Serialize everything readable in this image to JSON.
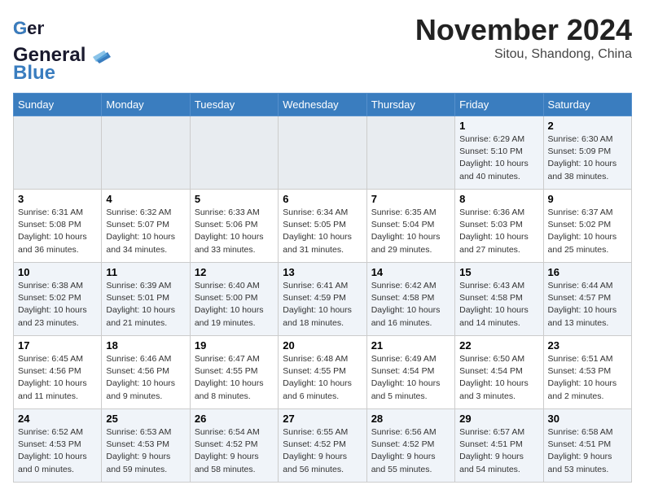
{
  "header": {
    "logo_line1": "General",
    "logo_line2": "Blue",
    "month": "November 2024",
    "location": "Sitou, Shandong, China"
  },
  "weekdays": [
    "Sunday",
    "Monday",
    "Tuesday",
    "Wednesday",
    "Thursday",
    "Friday",
    "Saturday"
  ],
  "weeks": [
    {
      "days": [
        {
          "num": "",
          "detail": "",
          "empty": true
        },
        {
          "num": "",
          "detail": "",
          "empty": true
        },
        {
          "num": "",
          "detail": "",
          "empty": true
        },
        {
          "num": "",
          "detail": "",
          "empty": true
        },
        {
          "num": "",
          "detail": "",
          "empty": true
        },
        {
          "num": "1",
          "detail": "Sunrise: 6:29 AM\nSunset: 5:10 PM\nDaylight: 10 hours\nand 40 minutes.",
          "empty": false
        },
        {
          "num": "2",
          "detail": "Sunrise: 6:30 AM\nSunset: 5:09 PM\nDaylight: 10 hours\nand 38 minutes.",
          "empty": false
        }
      ]
    },
    {
      "days": [
        {
          "num": "3",
          "detail": "Sunrise: 6:31 AM\nSunset: 5:08 PM\nDaylight: 10 hours\nand 36 minutes.",
          "empty": false
        },
        {
          "num": "4",
          "detail": "Sunrise: 6:32 AM\nSunset: 5:07 PM\nDaylight: 10 hours\nand 34 minutes.",
          "empty": false
        },
        {
          "num": "5",
          "detail": "Sunrise: 6:33 AM\nSunset: 5:06 PM\nDaylight: 10 hours\nand 33 minutes.",
          "empty": false
        },
        {
          "num": "6",
          "detail": "Sunrise: 6:34 AM\nSunset: 5:05 PM\nDaylight: 10 hours\nand 31 minutes.",
          "empty": false
        },
        {
          "num": "7",
          "detail": "Sunrise: 6:35 AM\nSunset: 5:04 PM\nDaylight: 10 hours\nand 29 minutes.",
          "empty": false
        },
        {
          "num": "8",
          "detail": "Sunrise: 6:36 AM\nSunset: 5:03 PM\nDaylight: 10 hours\nand 27 minutes.",
          "empty": false
        },
        {
          "num": "9",
          "detail": "Sunrise: 6:37 AM\nSunset: 5:02 PM\nDaylight: 10 hours\nand 25 minutes.",
          "empty": false
        }
      ]
    },
    {
      "days": [
        {
          "num": "10",
          "detail": "Sunrise: 6:38 AM\nSunset: 5:02 PM\nDaylight: 10 hours\nand 23 minutes.",
          "empty": false
        },
        {
          "num": "11",
          "detail": "Sunrise: 6:39 AM\nSunset: 5:01 PM\nDaylight: 10 hours\nand 21 minutes.",
          "empty": false
        },
        {
          "num": "12",
          "detail": "Sunrise: 6:40 AM\nSunset: 5:00 PM\nDaylight: 10 hours\nand 19 minutes.",
          "empty": false
        },
        {
          "num": "13",
          "detail": "Sunrise: 6:41 AM\nSunset: 4:59 PM\nDaylight: 10 hours\nand 18 minutes.",
          "empty": false
        },
        {
          "num": "14",
          "detail": "Sunrise: 6:42 AM\nSunset: 4:58 PM\nDaylight: 10 hours\nand 16 minutes.",
          "empty": false
        },
        {
          "num": "15",
          "detail": "Sunrise: 6:43 AM\nSunset: 4:58 PM\nDaylight: 10 hours\nand 14 minutes.",
          "empty": false
        },
        {
          "num": "16",
          "detail": "Sunrise: 6:44 AM\nSunset: 4:57 PM\nDaylight: 10 hours\nand 13 minutes.",
          "empty": false
        }
      ]
    },
    {
      "days": [
        {
          "num": "17",
          "detail": "Sunrise: 6:45 AM\nSunset: 4:56 PM\nDaylight: 10 hours\nand 11 minutes.",
          "empty": false
        },
        {
          "num": "18",
          "detail": "Sunrise: 6:46 AM\nSunset: 4:56 PM\nDaylight: 10 hours\nand 9 minutes.",
          "empty": false
        },
        {
          "num": "19",
          "detail": "Sunrise: 6:47 AM\nSunset: 4:55 PM\nDaylight: 10 hours\nand 8 minutes.",
          "empty": false
        },
        {
          "num": "20",
          "detail": "Sunrise: 6:48 AM\nSunset: 4:55 PM\nDaylight: 10 hours\nand 6 minutes.",
          "empty": false
        },
        {
          "num": "21",
          "detail": "Sunrise: 6:49 AM\nSunset: 4:54 PM\nDaylight: 10 hours\nand 5 minutes.",
          "empty": false
        },
        {
          "num": "22",
          "detail": "Sunrise: 6:50 AM\nSunset: 4:54 PM\nDaylight: 10 hours\nand 3 minutes.",
          "empty": false
        },
        {
          "num": "23",
          "detail": "Sunrise: 6:51 AM\nSunset: 4:53 PM\nDaylight: 10 hours\nand 2 minutes.",
          "empty": false
        }
      ]
    },
    {
      "days": [
        {
          "num": "24",
          "detail": "Sunrise: 6:52 AM\nSunset: 4:53 PM\nDaylight: 10 hours\nand 0 minutes.",
          "empty": false
        },
        {
          "num": "25",
          "detail": "Sunrise: 6:53 AM\nSunset: 4:53 PM\nDaylight: 9 hours\nand 59 minutes.",
          "empty": false
        },
        {
          "num": "26",
          "detail": "Sunrise: 6:54 AM\nSunset: 4:52 PM\nDaylight: 9 hours\nand 58 minutes.",
          "empty": false
        },
        {
          "num": "27",
          "detail": "Sunrise: 6:55 AM\nSunset: 4:52 PM\nDaylight: 9 hours\nand 56 minutes.",
          "empty": false
        },
        {
          "num": "28",
          "detail": "Sunrise: 6:56 AM\nSunset: 4:52 PM\nDaylight: 9 hours\nand 55 minutes.",
          "empty": false
        },
        {
          "num": "29",
          "detail": "Sunrise: 6:57 AM\nSunset: 4:51 PM\nDaylight: 9 hours\nand 54 minutes.",
          "empty": false
        },
        {
          "num": "30",
          "detail": "Sunrise: 6:58 AM\nSunset: 4:51 PM\nDaylight: 9 hours\nand 53 minutes.",
          "empty": false
        }
      ]
    }
  ]
}
